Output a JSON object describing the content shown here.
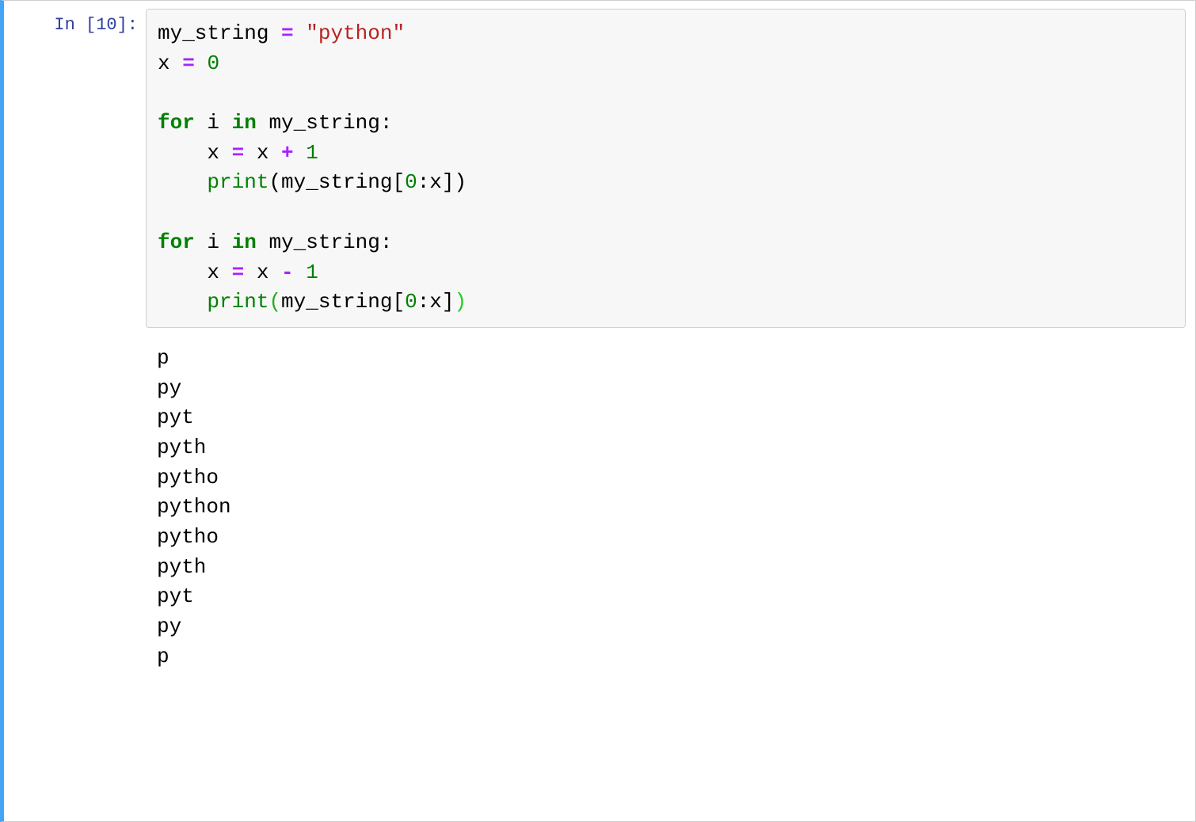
{
  "cell": {
    "prompt_prefix": "In [",
    "execution_count": "10",
    "prompt_suffix": "]:",
    "code_tokens": [
      {
        "t": "my_string ",
        "c": "plain"
      },
      {
        "t": "=",
        "c": "op"
      },
      {
        "t": " ",
        "c": "plain"
      },
      {
        "t": "\"python\"",
        "c": "str"
      },
      {
        "t": "\n",
        "c": "plain"
      },
      {
        "t": "x ",
        "c": "plain"
      },
      {
        "t": "=",
        "c": "op"
      },
      {
        "t": " ",
        "c": "plain"
      },
      {
        "t": "0",
        "c": "num"
      },
      {
        "t": "\n",
        "c": "plain"
      },
      {
        "t": "\n",
        "c": "plain"
      },
      {
        "t": "for",
        "c": "kw"
      },
      {
        "t": " i ",
        "c": "plain"
      },
      {
        "t": "in",
        "c": "kw"
      },
      {
        "t": " my_string:",
        "c": "plain"
      },
      {
        "t": "\n",
        "c": "plain"
      },
      {
        "t": "    x ",
        "c": "plain"
      },
      {
        "t": "=",
        "c": "op"
      },
      {
        "t": " x ",
        "c": "plain"
      },
      {
        "t": "+",
        "c": "op"
      },
      {
        "t": " ",
        "c": "plain"
      },
      {
        "t": "1",
        "c": "num"
      },
      {
        "t": "\n",
        "c": "plain"
      },
      {
        "t": "    ",
        "c": "plain"
      },
      {
        "t": "print",
        "c": "builtin"
      },
      {
        "t": "(my_string[",
        "c": "plain"
      },
      {
        "t": "0",
        "c": "num"
      },
      {
        "t": ":x])",
        "c": "plain"
      },
      {
        "t": "\n",
        "c": "plain"
      },
      {
        "t": "\n",
        "c": "plain"
      },
      {
        "t": "for",
        "c": "kw"
      },
      {
        "t": " i ",
        "c": "plain"
      },
      {
        "t": "in",
        "c": "kw"
      },
      {
        "t": " my_string:",
        "c": "plain"
      },
      {
        "t": "\n",
        "c": "plain"
      },
      {
        "t": "    x ",
        "c": "plain"
      },
      {
        "t": "=",
        "c": "op"
      },
      {
        "t": " x ",
        "c": "plain"
      },
      {
        "t": "-",
        "c": "op"
      },
      {
        "t": " ",
        "c": "plain"
      },
      {
        "t": "1",
        "c": "num"
      },
      {
        "t": "\n",
        "c": "plain"
      },
      {
        "t": "    ",
        "c": "plain"
      },
      {
        "t": "print",
        "c": "builtin"
      },
      {
        "t": "(",
        "c": "last-paren-open"
      },
      {
        "t": "my_string[",
        "c": "plain"
      },
      {
        "t": "0",
        "c": "num"
      },
      {
        "t": ":x]",
        "c": "plain"
      },
      {
        "t": ")",
        "c": "last-paren-close"
      }
    ],
    "output_lines": [
      "p",
      "py",
      "pyt",
      "pyth",
      "pytho",
      "python",
      "pytho",
      "pyth",
      "pyt",
      "py",
      "p",
      ""
    ]
  }
}
